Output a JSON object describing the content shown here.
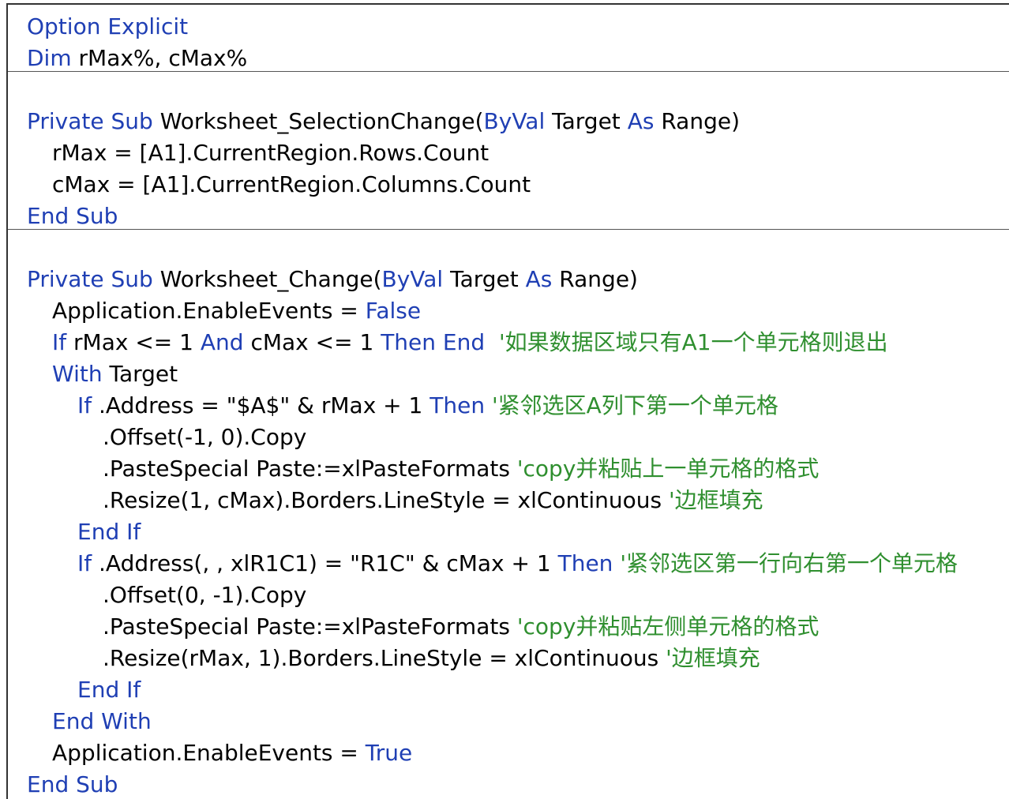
{
  "colors": {
    "keyword": "#1f3fb4",
    "comment": "#2f8f2f",
    "text": "#000000",
    "border": "#333333"
  },
  "code": {
    "lines": [
      {
        "indent": 0,
        "tokens": [
          {
            "t": "kw",
            "v": "Option Explicit"
          }
        ]
      },
      {
        "indent": 0,
        "tokens": [
          {
            "t": "kw",
            "v": "Dim"
          },
          {
            "t": "tx",
            "v": " rMax%, cMax%"
          }
        ]
      },
      {
        "indent": 0,
        "tokens": []
      },
      {
        "indent": 0,
        "tokens": [
          {
            "t": "kw",
            "v": "Private Sub"
          },
          {
            "t": "tx",
            "v": " Worksheet_SelectionChange("
          },
          {
            "t": "kw",
            "v": "ByVal"
          },
          {
            "t": "tx",
            "v": " Target "
          },
          {
            "t": "kw",
            "v": "As"
          },
          {
            "t": "tx",
            "v": " Range)"
          }
        ]
      },
      {
        "indent": 1,
        "tokens": [
          {
            "t": "tx",
            "v": "rMax = [A1].CurrentRegion.Rows.Count"
          }
        ]
      },
      {
        "indent": 1,
        "tokens": [
          {
            "t": "tx",
            "v": "cMax = [A1].CurrentRegion.Columns.Count"
          }
        ]
      },
      {
        "indent": 0,
        "tokens": [
          {
            "t": "kw",
            "v": "End Sub"
          }
        ]
      },
      {
        "indent": 0,
        "tokens": []
      },
      {
        "indent": 0,
        "tokens": [
          {
            "t": "kw",
            "v": "Private Sub"
          },
          {
            "t": "tx",
            "v": " Worksheet_Change("
          },
          {
            "t": "kw",
            "v": "ByVal"
          },
          {
            "t": "tx",
            "v": " Target "
          },
          {
            "t": "kw",
            "v": "As"
          },
          {
            "t": "tx",
            "v": " Range)"
          }
        ]
      },
      {
        "indent": 1,
        "tokens": [
          {
            "t": "tx",
            "v": "Application.EnableEvents = "
          },
          {
            "t": "kw",
            "v": "False"
          }
        ]
      },
      {
        "indent": 1,
        "tokens": [
          {
            "t": "kw",
            "v": "If"
          },
          {
            "t": "tx",
            "v": " rMax <= 1 "
          },
          {
            "t": "kw",
            "v": "And"
          },
          {
            "t": "tx",
            "v": " cMax <= 1 "
          },
          {
            "t": "kw",
            "v": "Then End"
          },
          {
            "t": "tx",
            "v": "  "
          },
          {
            "t": "cm",
            "v": "'如果数据区域只有A1一个单元格则退出"
          }
        ]
      },
      {
        "indent": 1,
        "tokens": [
          {
            "t": "kw",
            "v": "With"
          },
          {
            "t": "tx",
            "v": " Target"
          }
        ]
      },
      {
        "indent": 2,
        "tokens": [
          {
            "t": "kw",
            "v": "If"
          },
          {
            "t": "tx",
            "v": " .Address = \"$A$\" & rMax + 1 "
          },
          {
            "t": "kw",
            "v": "Then"
          },
          {
            "t": "tx",
            "v": " "
          },
          {
            "t": "cm",
            "v": "'紧邻选区A列下第一个单元格"
          }
        ]
      },
      {
        "indent": 3,
        "tokens": [
          {
            "t": "tx",
            "v": ".Offset(-1, 0).Copy"
          }
        ]
      },
      {
        "indent": 3,
        "tokens": [
          {
            "t": "tx",
            "v": ".PasteSpecial Paste:=xlPasteFormats "
          },
          {
            "t": "cm",
            "v": "'copy并粘贴上一单元格的格式"
          }
        ]
      },
      {
        "indent": 3,
        "tokens": [
          {
            "t": "tx",
            "v": ".Resize(1, cMax).Borders.LineStyle = xlContinuous "
          },
          {
            "t": "cm",
            "v": "'边框填充"
          }
        ]
      },
      {
        "indent": 2,
        "tokens": [
          {
            "t": "kw",
            "v": "End If"
          }
        ]
      },
      {
        "indent": 2,
        "tokens": [
          {
            "t": "kw",
            "v": "If"
          },
          {
            "t": "tx",
            "v": " .Address(, , xlR1C1) = \"R1C\" & cMax + 1 "
          },
          {
            "t": "kw",
            "v": "Then"
          },
          {
            "t": "tx",
            "v": " "
          },
          {
            "t": "cm",
            "v": "'紧邻选区第一行向右第一个单元格"
          }
        ]
      },
      {
        "indent": 3,
        "tokens": [
          {
            "t": "tx",
            "v": ".Offset(0, -1).Copy"
          }
        ]
      },
      {
        "indent": 3,
        "tokens": [
          {
            "t": "tx",
            "v": ".PasteSpecial Paste:=xlPasteFormats "
          },
          {
            "t": "cm",
            "v": "'copy并粘贴左侧单元格的格式"
          }
        ]
      },
      {
        "indent": 3,
        "tokens": [
          {
            "t": "tx",
            "v": ".Resize(rMax, 1).Borders.LineStyle = xlContinuous "
          },
          {
            "t": "cm",
            "v": "'边框填充"
          }
        ]
      },
      {
        "indent": 2,
        "tokens": [
          {
            "t": "kw",
            "v": "End If"
          }
        ]
      },
      {
        "indent": 1,
        "tokens": [
          {
            "t": "kw",
            "v": "End With"
          }
        ]
      },
      {
        "indent": 1,
        "tokens": [
          {
            "t": "tx",
            "v": "Application.EnableEvents = "
          },
          {
            "t": "kw",
            "v": "True"
          }
        ]
      },
      {
        "indent": 0,
        "tokens": [
          {
            "t": "kw",
            "v": "End Sub"
          }
        ]
      }
    ]
  }
}
